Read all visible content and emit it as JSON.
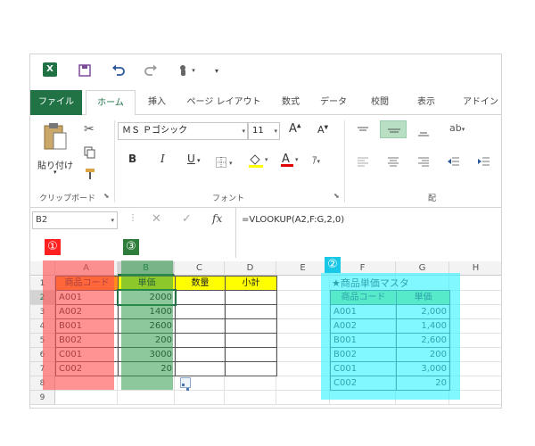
{
  "toolbar": {
    "save": "save-icon",
    "undo": "undo-icon",
    "redo": "redo-icon",
    "touch": "touch-icon",
    "more": "▾"
  },
  "tabs": [
    "ファイル",
    "ホーム",
    "挿入",
    "ページ レイアウト",
    "数式",
    "データ",
    "校閲",
    "表示",
    "アドイン"
  ],
  "ribbon": {
    "paste_label": "貼り付け",
    "clipboard_label": "クリップボード",
    "font_name": "ＭＳ Ｐゴシック",
    "font_size": "11",
    "bold": "B",
    "italic": "I",
    "underline": "U",
    "font_group_label": "フォント",
    "grow_font": "A",
    "shrink_font": "A",
    "align_group_label": "配"
  },
  "formula_bar": {
    "name_box": "B2",
    "fx": "fx",
    "formula": "=VLOOKUP(A2,F:G,2,0)"
  },
  "columns": [
    "A",
    "B",
    "C",
    "D",
    "E",
    "F",
    "G",
    "H"
  ],
  "rows": [
    "1",
    "2",
    "3",
    "4",
    "5",
    "6",
    "7",
    "8",
    "9"
  ],
  "table1": {
    "headers": [
      "商品コード",
      "単価",
      "数量",
      "小計"
    ],
    "rows": [
      [
        "A001",
        "2000"
      ],
      [
        "A002",
        "1400"
      ],
      [
        "B001",
        "2600"
      ],
      [
        "B002",
        "200"
      ],
      [
        "C001",
        "3000"
      ],
      [
        "C002",
        "20"
      ]
    ]
  },
  "master": {
    "title": "★商品単価マスタ",
    "headers": [
      "商品コード",
      "単価"
    ],
    "rows": [
      [
        "A001",
        "2,000"
      ],
      [
        "A002",
        "1,400"
      ],
      [
        "B001",
        "2,600"
      ],
      [
        "B002",
        "200"
      ],
      [
        "C001",
        "3,000"
      ],
      [
        "C002",
        "20"
      ]
    ]
  },
  "badges": [
    "①",
    "②",
    "③"
  ],
  "colors": {
    "excel_green": "#217346",
    "header_orange": "#ff8c1a",
    "header_yellow": "#ffff00",
    "header_green": "#8ed973",
    "overlay_red": "#ff5050",
    "overlay_green": "#2f9a4c",
    "overlay_cyan": "#33f2ff"
  }
}
